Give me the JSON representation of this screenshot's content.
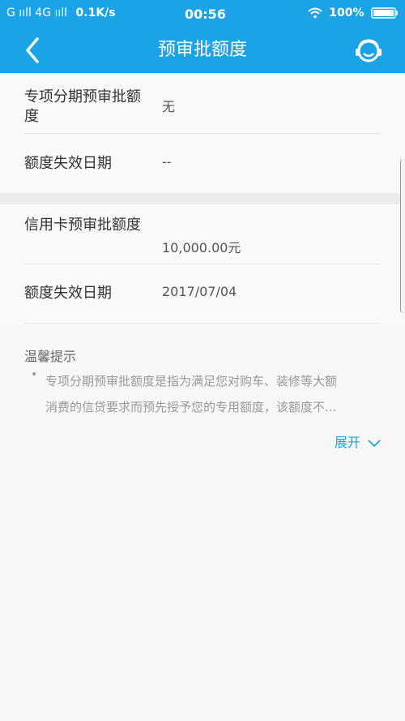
{
  "status_bar": {
    "carrier": "G ııll 4G ııll",
    "speed": "0.1K/s",
    "time": "00:56",
    "battery": "100%"
  },
  "header": {
    "title": "预审批额度",
    "back_icon": "chevron-left-icon",
    "service_icon": "customer-service-icon"
  },
  "sections": [
    {
      "rows": [
        {
          "label": "专项分期预审批额度",
          "value": "无"
        },
        {
          "label": "额度失效日期",
          "value": "--"
        }
      ]
    },
    {
      "rows": [
        {
          "label": "信用卡预审批额度",
          "value": "10,000.00元"
        },
        {
          "label": "额度失效日期",
          "value": "2017/07/04"
        }
      ]
    }
  ],
  "tips": {
    "title": "温馨提示",
    "bullet": "•",
    "lines": [
      "专项分期预审批额度是指为满足您对购车、装修等大额",
      "消费的信贷要求而预先授予您的专用额度，该额度不..."
    ]
  },
  "expand": {
    "label": "展开"
  },
  "colors": {
    "primary": "#1aa3e6",
    "background": "#f7f7f7"
  }
}
